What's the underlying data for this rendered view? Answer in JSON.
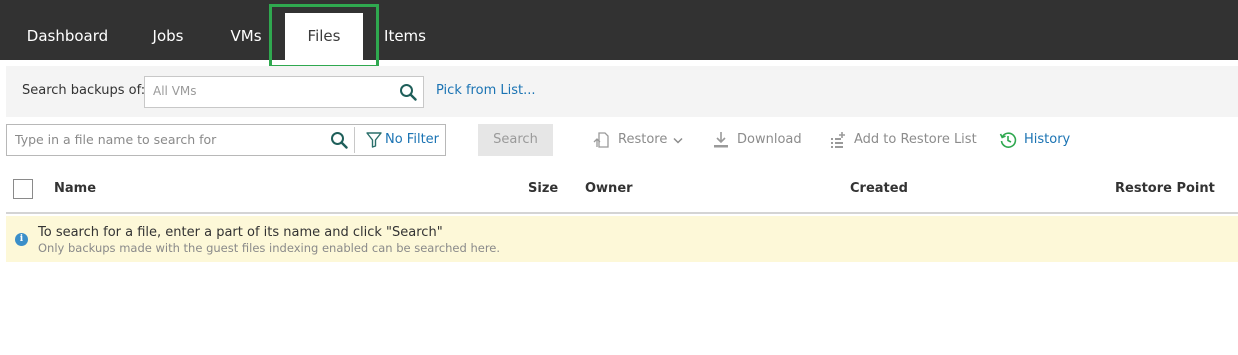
{
  "nav": {
    "tabs": [
      {
        "label": "Dashboard"
      },
      {
        "label": "Jobs"
      },
      {
        "label": "VMs"
      },
      {
        "label": "Files",
        "active": true
      },
      {
        "label": "Items"
      }
    ]
  },
  "search_backups": {
    "label": "Search backups of:",
    "placeholder": "All VMs",
    "pick_link": "Pick from List..."
  },
  "file_search": {
    "placeholder": "Type in a file name to search for",
    "filter_label": "No Filter",
    "search_button": "Search"
  },
  "toolbar": {
    "restore": "Restore",
    "download": "Download",
    "add_to_restore_list": "Add to Restore List",
    "history": "History"
  },
  "table": {
    "columns": [
      "Name",
      "Size",
      "Owner",
      "Created",
      "Restore Point"
    ]
  },
  "notice": {
    "title": "To search for a file, enter a part of its name and click \"Search\"",
    "subtitle": "Only backups made with the guest files indexing enabled can be searched here."
  },
  "colors": {
    "topbar": "#323232",
    "highlight": "#2fa84f",
    "link": "#1a73b3",
    "notice_bg": "#fdf8d8",
    "history_icon": "#2fa84f"
  },
  "icons": {
    "search": "search-icon",
    "filter": "filter-icon",
    "restore": "restore-icon",
    "download": "download-icon",
    "add_to_list": "add-to-list-icon",
    "history": "history-icon",
    "info": "info-icon",
    "chevron": "chevron-down-icon"
  }
}
